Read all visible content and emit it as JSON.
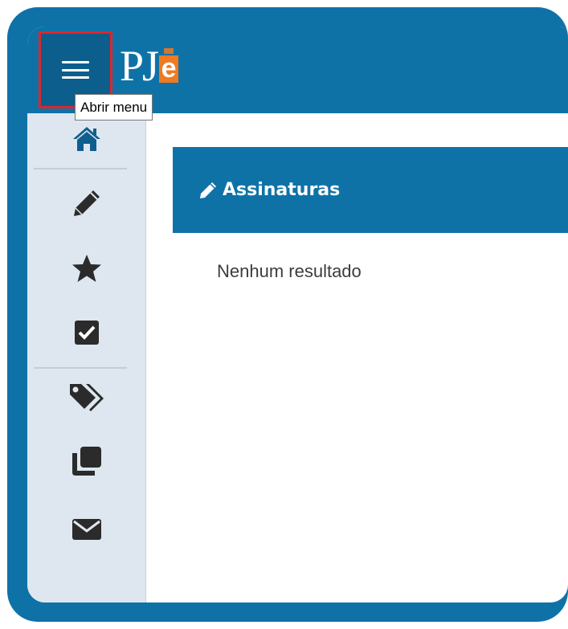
{
  "header": {
    "logo_text": "PJ",
    "logo_e": "e",
    "menu_button_tooltip": "Abrir menu"
  },
  "sidebar": {
    "items": [
      {
        "icon": "home-icon"
      },
      {
        "icon": "pencil-icon"
      },
      {
        "icon": "star-icon"
      },
      {
        "icon": "checkbox-icon"
      },
      {
        "icon": "tags-icon"
      },
      {
        "icon": "copy-icon"
      },
      {
        "icon": "envelope-icon"
      }
    ]
  },
  "panel": {
    "title": "Assinaturas",
    "icon": "pencil-icon",
    "empty_message": "Nenhum resultado"
  },
  "colors": {
    "brand_blue": "#0f72a7",
    "menu_button_bg": "#0c5e8c",
    "highlight_red": "#e0252b",
    "logo_orange": "#ee7a22",
    "sidebar_bg": "#dee7ef",
    "icon_dark": "#2b2b2b",
    "home_icon": "#0f5f8e"
  }
}
